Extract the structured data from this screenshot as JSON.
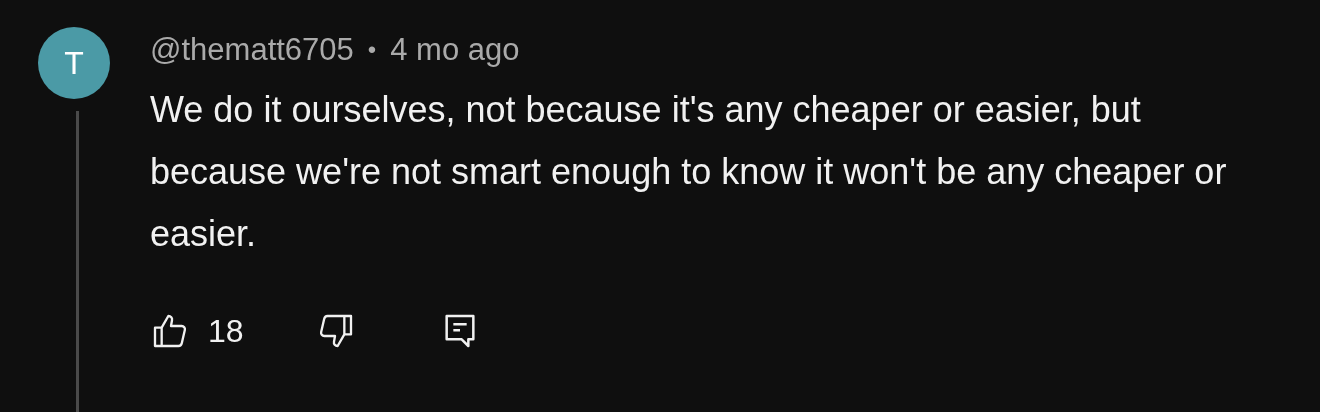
{
  "comment": {
    "avatar_letter": "T",
    "author": "@thematt6705",
    "separator": "•",
    "time": "4 mo ago",
    "text": "We do it ourselves, not because it's any cheaper or easier, but because we're not smart enough to know it won't be any cheaper or easier.",
    "likes": "18"
  }
}
